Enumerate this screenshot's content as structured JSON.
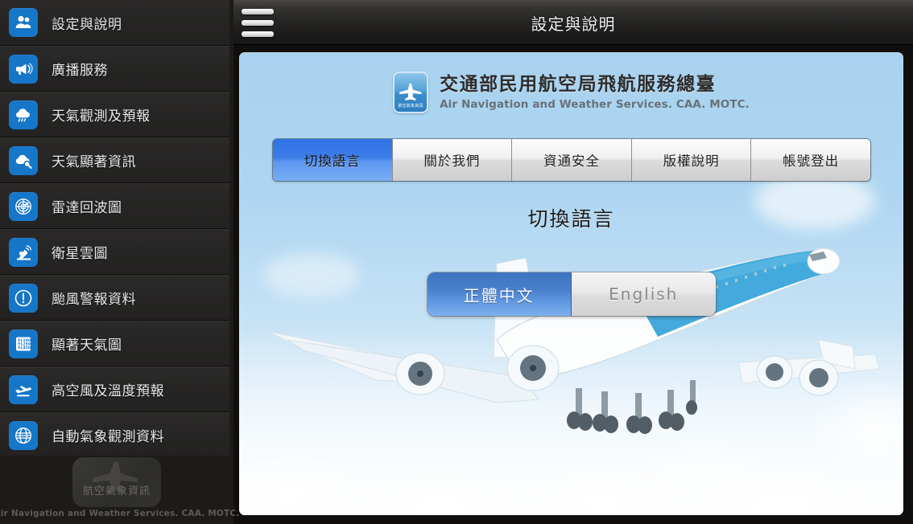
{
  "header": {
    "title": "設定與說明",
    "menu_icon": "hamburger-icon"
  },
  "sidebar": {
    "items": [
      {
        "label": "設定與說明",
        "icon": "users-settings-icon"
      },
      {
        "label": "廣播服務",
        "icon": "megaphone-icon"
      },
      {
        "label": "天氣觀測及預報",
        "icon": "cloud-rain-icon"
      },
      {
        "label": "天氣顯著資訊",
        "icon": "cloud-search-icon"
      },
      {
        "label": "雷達回波圖",
        "icon": "radar-icon"
      },
      {
        "label": "衛星雲圖",
        "icon": "satellite-dish-icon"
      },
      {
        "label": "颱風警報資料",
        "icon": "exclamation-circle-icon"
      },
      {
        "label": "顯著天氣圖",
        "icon": "flight-level-chart-icon"
      },
      {
        "label": "高空風及溫度預報",
        "icon": "takeoff-plane-icon"
      },
      {
        "label": "自動氣象觀測資料",
        "icon": "globe-icon"
      }
    ],
    "footer": {
      "logo_label": "航空氣象資訊",
      "caption": "Air Navigation and Weather Services. CAA. MOTC."
    }
  },
  "content": {
    "brand": {
      "icon": "airplane-logo-icon",
      "icon_caption": "航空氣象資訊",
      "title": "交通部民用航空局飛航服務總臺",
      "subtitle": "Air Navigation and Weather Services. CAA. MOTC."
    },
    "tabs": [
      {
        "label": "切換語言",
        "active": true
      },
      {
        "label": "關於我們",
        "active": false
      },
      {
        "label": "資通安全",
        "active": false
      },
      {
        "label": "版權說明",
        "active": false
      },
      {
        "label": "帳號登出",
        "active": false
      }
    ],
    "section_title": "切換語言",
    "language_toggle": {
      "selected": "正體中文",
      "options": [
        {
          "label": "正體中文",
          "selected": true
        },
        {
          "label": "English",
          "selected": false
        }
      ]
    },
    "artwork": "boeing-747-landing-photo"
  },
  "colors": {
    "accent_blue": "#1676c8",
    "tab_active_blue": "#3d7eea",
    "panel_sky": "#a8d2ef",
    "sidebar_bg": "#262524",
    "topbar_dark": "#232221"
  }
}
